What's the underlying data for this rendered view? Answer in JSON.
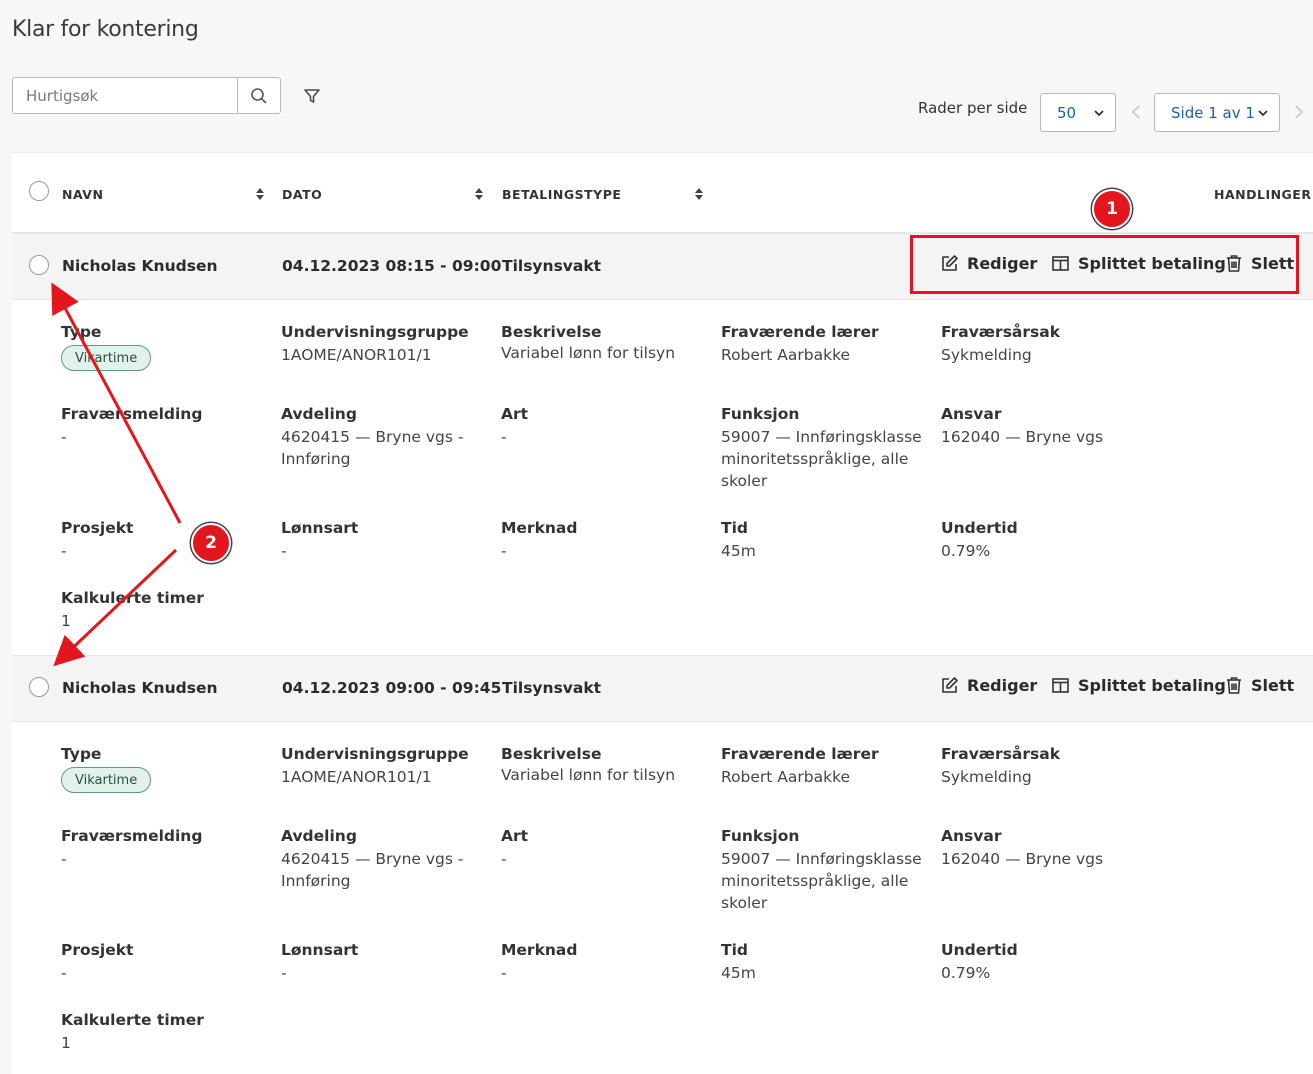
{
  "page": {
    "title": "Klar for kontering"
  },
  "search": {
    "placeholder": "Hurtigsøk"
  },
  "pagination": {
    "rows_label": "Rader per side",
    "rows_value": "50",
    "page_value": "Side 1 av 1"
  },
  "table": {
    "headers": {
      "name": "NAVN",
      "date": "DATO",
      "payment_type": "BETALINGSTYPE",
      "actions": "HANDLINGER"
    },
    "rows": [
      {
        "name": "Nicholas Knudsen",
        "date": "04.12.2023 08:15 - 09:00",
        "payment_type": "Tilsynsvakt",
        "actions": {
          "edit": "Rediger",
          "split": "Splittet betaling",
          "delete": "Slett"
        },
        "details": {
          "type_label": "Type",
          "type_badge": "Vikartime",
          "group_label": "Undervisningsgruppe",
          "group_value": "1AOME/ANOR101/1",
          "desc_label": "Beskrivelse",
          "desc_value": "Variabel lønn for tilsyn",
          "teacher_label": "Fraværende lærer",
          "teacher_value": "Robert Aarbakke",
          "cause_label": "Fraværsårsak",
          "cause_value": "Sykmelding",
          "notice_label": "Fraværsmelding",
          "notice_value": "-",
          "dept_label": "Avdeling",
          "dept_value_1": "4620415 — Bryne vgs -",
          "dept_value_2": "Innføring",
          "art_label": "Art",
          "art_value": "-",
          "func_label": "Funksjon",
          "func_value_1": "59007 — Innføringsklasse",
          "func_value_2": "minoritetsspråklige, alle",
          "func_value_3": "skoler",
          "resp_label": "Ansvar",
          "resp_value": "162040 — Bryne vgs",
          "project_label": "Prosjekt",
          "project_value": "-",
          "wage_label": "Lønnsart",
          "wage_value": "-",
          "remark_label": "Merknad",
          "remark_value": "-",
          "time_label": "Tid",
          "time_value": "45m",
          "under_label": "Undertid",
          "under_value": "0.79%",
          "calc_label": "Kalkulerte timer",
          "calc_value": "1"
        }
      },
      {
        "name": "Nicholas Knudsen",
        "date": "04.12.2023 09:00 - 09:45",
        "payment_type": "Tilsynsvakt",
        "actions": {
          "edit": "Rediger",
          "split": "Splittet betaling",
          "delete": "Slett"
        },
        "details": {
          "type_label": "Type",
          "type_badge": "Vikartime",
          "group_label": "Undervisningsgruppe",
          "group_value": "1AOME/ANOR101/1",
          "desc_label": "Beskrivelse",
          "desc_value": "Variabel lønn for tilsyn",
          "teacher_label": "Fraværende lærer",
          "teacher_value": "Robert Aarbakke",
          "cause_label": "Fraværsårsak",
          "cause_value": "Sykmelding",
          "notice_label": "Fraværsmelding",
          "notice_value": "-",
          "dept_label": "Avdeling",
          "dept_value_1": "4620415 — Bryne vgs -",
          "dept_value_2": "Innføring",
          "art_label": "Art",
          "art_value": "-",
          "func_label": "Funksjon",
          "func_value_1": "59007 — Innføringsklasse",
          "func_value_2": "minoritetsspråklige, alle",
          "func_value_3": "skoler",
          "resp_label": "Ansvar",
          "resp_value": "162040 — Bryne vgs",
          "project_label": "Prosjekt",
          "project_value": "-",
          "wage_label": "Lønnsart",
          "wage_value": "-",
          "remark_label": "Merknad",
          "remark_value": "-",
          "time_label": "Tid",
          "time_value": "45m",
          "under_label": "Undertid",
          "under_value": "0.79%",
          "calc_label": "Kalkulerte timer",
          "calc_value": "1"
        }
      }
    ]
  },
  "annotations": {
    "marker_1": "1",
    "marker_2": "2"
  },
  "colors": {
    "annotation": "#e3151d",
    "badge_bg": "#e2f2ea",
    "badge_border": "#5e9b80",
    "link": "#1f5f9f"
  }
}
